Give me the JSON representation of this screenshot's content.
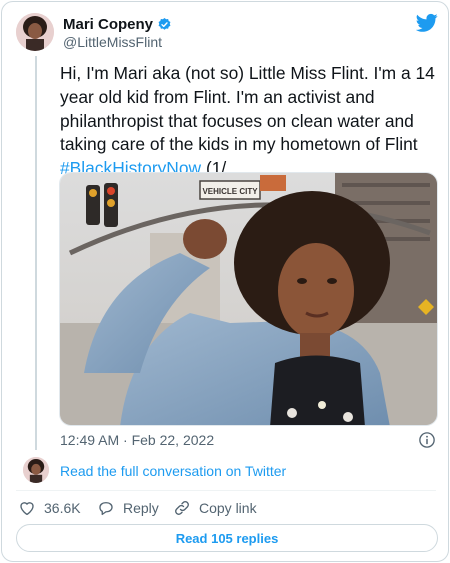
{
  "author": {
    "display_name": "Mari Copeny",
    "handle": "@LittleMissFlint",
    "verified": true
  },
  "tweet": {
    "text": "Hi, I'm Mari aka (not so) Little Miss Flint. I'm a 14 year old kid from Flint. I'm an activist and philanthropist that focuses on clean water and taking care of the kids in my hometown of Flint ",
    "hashtag": "#BlackHistoryNow",
    "suffix": " (1/",
    "image_sign_text": "VEHICLE CITY",
    "timestamp": "12:49 AM · Feb 22, 2022"
  },
  "conversation": {
    "link_label": "Read the full conversation on Twitter"
  },
  "actions": {
    "like_count": "36.6K",
    "reply_label": "Reply",
    "copy_link_label": "Copy link"
  },
  "footer": {
    "read_replies_label": "Read 105 replies"
  },
  "colors": {
    "accent": "#1d9bf0",
    "text": "#0f1419",
    "muted": "#536471",
    "border": "#cfd9de"
  },
  "icons": [
    "twitter-bird-icon",
    "verified-badge-icon",
    "info-icon",
    "heart-icon",
    "reply-icon",
    "link-icon"
  ]
}
